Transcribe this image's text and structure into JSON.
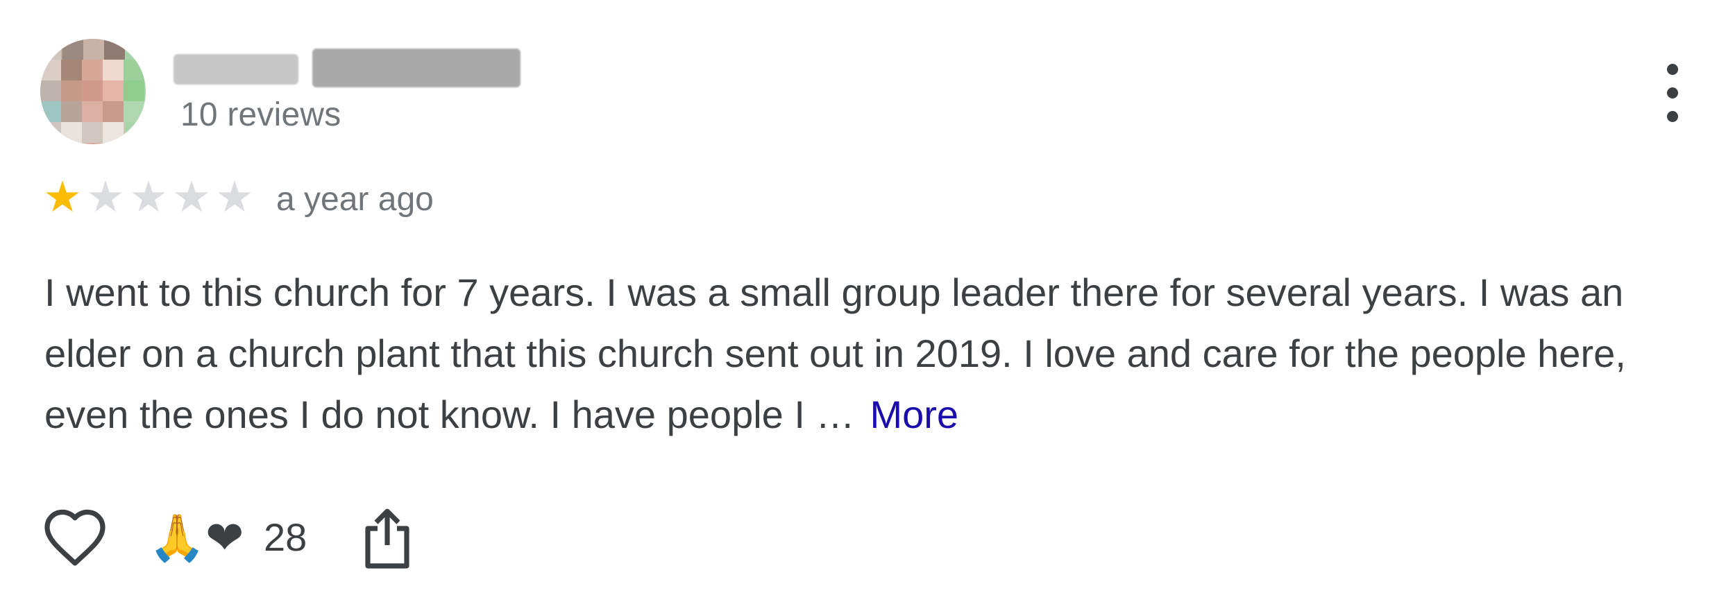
{
  "reviewer": {
    "name": "",
    "review_count": "10 reviews"
  },
  "rating": {
    "stars": 1,
    "max_stars": 5,
    "time_ago": "a year ago"
  },
  "review": {
    "text": "I went to this church for 7 years. I was a small group leader there for several years. I was an elder on a church plant that this church sent out in 2019. I love and care for the people here, even the ones I do not know. I have people I …",
    "more_label": "More"
  },
  "actions": {
    "reactions": "🙏❤",
    "reaction_count": "28"
  },
  "icons": {
    "like": "heart-outline-icon",
    "share": "share-icon",
    "menu": "more-vert-icon",
    "star": "star-icon"
  },
  "colors": {
    "star_filled": "#fbbc04",
    "star_empty": "#dadce0",
    "link": "#1a0dab",
    "text": "#3c4043",
    "muted": "#70757a"
  }
}
